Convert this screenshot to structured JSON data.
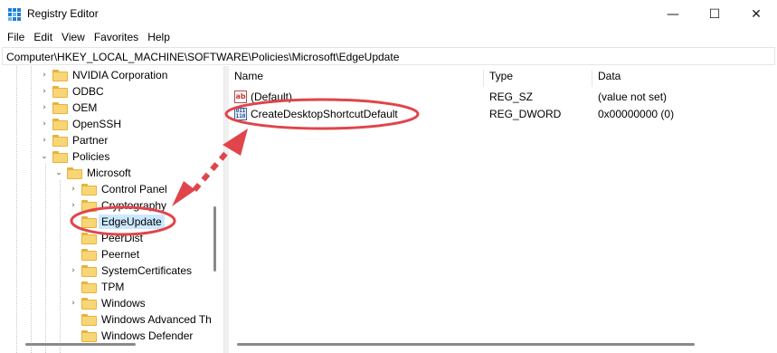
{
  "window": {
    "title": "Registry Editor",
    "min_glyph": "—",
    "max_glyph": "☐",
    "close_glyph": "✕",
    "app_icon": "registry-editor-icon"
  },
  "menu": [
    "File",
    "Edit",
    "View",
    "Favorites",
    "Help"
  ],
  "address": "Computer\\HKEY_LOCAL_MACHINE\\SOFTWARE\\Policies\\Microsoft\\EdgeUpdate",
  "tree": [
    {
      "label": "NVIDIA Corporation",
      "expander": "›"
    },
    {
      "label": "ODBC",
      "expander": "›"
    },
    {
      "label": "OEM",
      "expander": "›"
    },
    {
      "label": "OpenSSH",
      "expander": "›"
    },
    {
      "label": "Partner",
      "expander": "›"
    },
    {
      "label": "Policies",
      "expander": "⌄"
    },
    {
      "label": "Microsoft",
      "expander": "⌄"
    },
    {
      "label": "Control Panel",
      "expander": "›"
    },
    {
      "label": "Cryptography",
      "expander": "›"
    },
    {
      "label": "EdgeUpdate",
      "expander": ""
    },
    {
      "label": "PeerDist",
      "expander": ""
    },
    {
      "label": "Peernet",
      "expander": ""
    },
    {
      "label": "SystemCertificates",
      "expander": "›"
    },
    {
      "label": "TPM",
      "expander": ""
    },
    {
      "label": "Windows",
      "expander": "›"
    },
    {
      "label": "Windows Advanced Th",
      "expander": ""
    },
    {
      "label": "Windows Defender",
      "expander": ""
    }
  ],
  "selected_key": "EdgeUpdate",
  "list": {
    "columns": [
      "Name",
      "Type",
      "Data"
    ],
    "rows": [
      {
        "icon": "string-value-icon",
        "icon_glyph": "ab",
        "name": "(Default)",
        "type": "REG_SZ",
        "data": "(value not set)"
      },
      {
        "icon": "dword-value-icon",
        "icon_glyph": "011\n110",
        "name": "CreateDesktopShortcutDefault",
        "type": "REG_DWORD",
        "data": "0x00000000 (0)"
      }
    ]
  },
  "colors": {
    "annotation_red": "#e0454b",
    "selection": "#cce8ff",
    "folder": "#f8d675"
  }
}
